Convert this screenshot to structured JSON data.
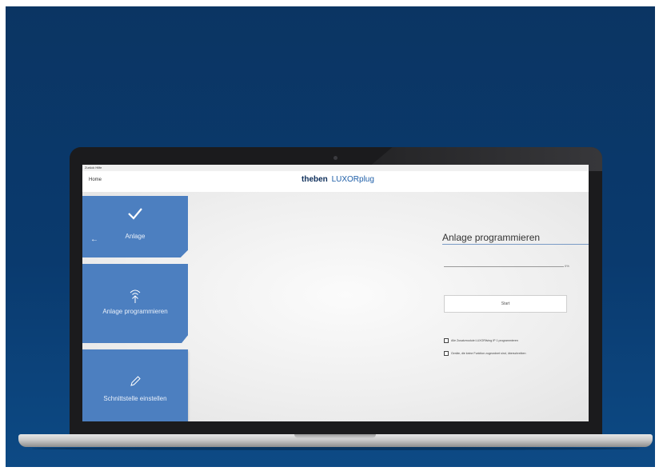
{
  "sysbar": {
    "text": "Zurück  Hilfe"
  },
  "header": {
    "home_label": "Home",
    "brand_logo": "theben",
    "brand_name": "LUXORplug"
  },
  "sidebar": {
    "items": [
      {
        "label": "Anlage",
        "icon": "check-icon",
        "back_arrow": "←"
      },
      {
        "label": "Anlage programmieren",
        "icon": "wireless-upload-icon"
      },
      {
        "label": "Schnittstelle einstellen",
        "icon": "pencil-icon"
      }
    ]
  },
  "panel": {
    "title": "Anlage programmieren",
    "progress_percent": 0,
    "progress_text": "0%",
    "start_label": "Start",
    "checkboxes": [
      {
        "label": "Alle Zusatzmodule LUXORliving IP 1 programmieren",
        "checked": false
      },
      {
        "label": "Geräte, die keine Funktion zugeordnet sind, überschreiben",
        "checked": false
      }
    ]
  },
  "colors": {
    "background": "#0b3563",
    "tile": "#4c7fc0",
    "accent": "#1f5fa8"
  }
}
